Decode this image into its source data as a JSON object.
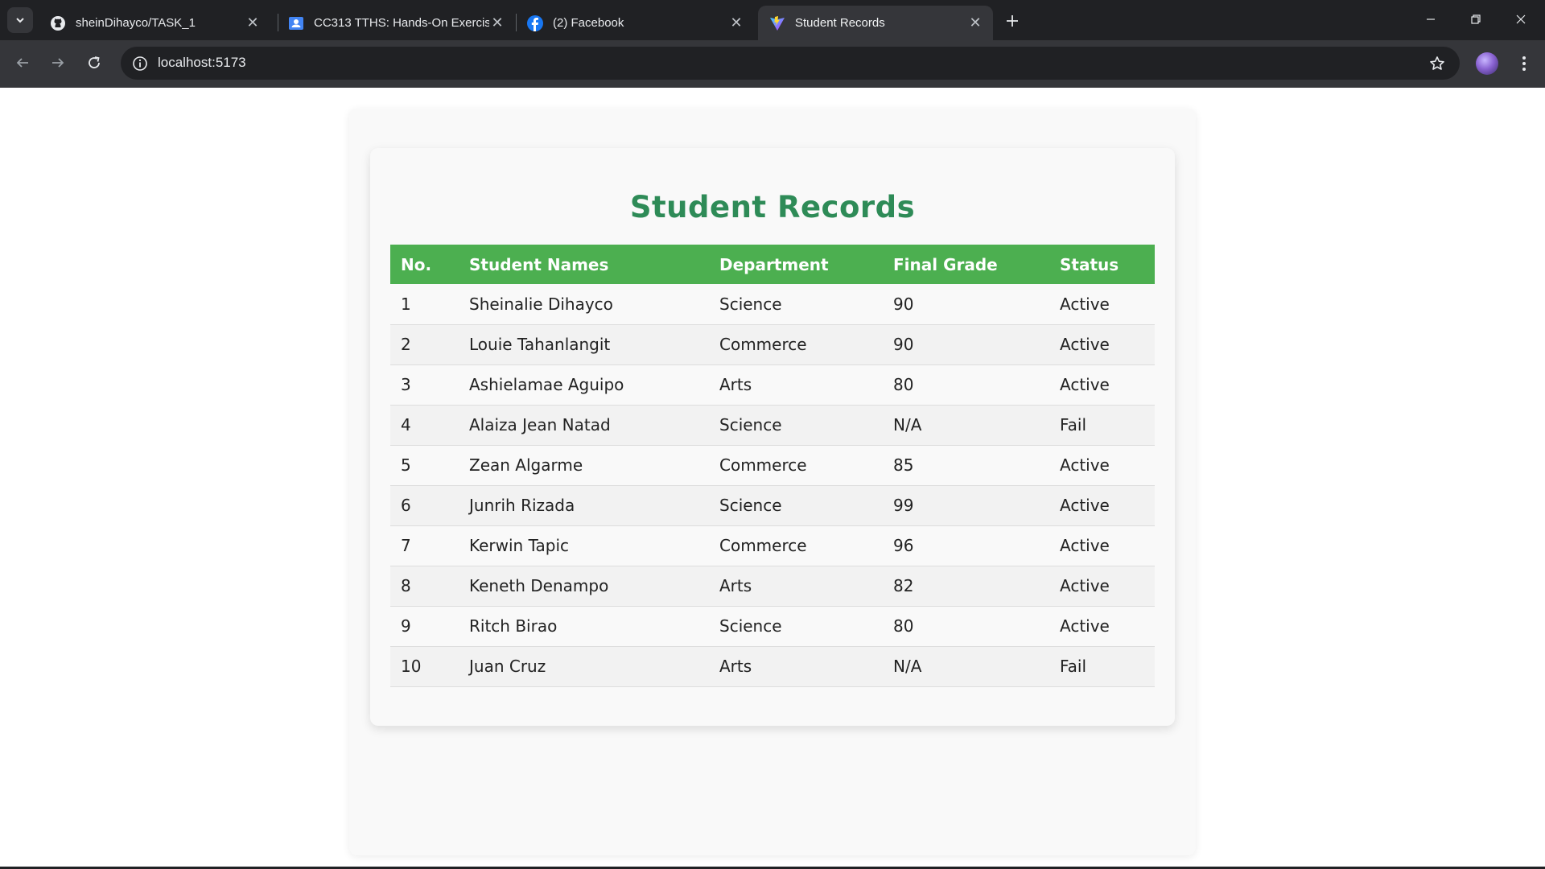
{
  "browser": {
    "tabs": [
      {
        "title": "sheinDihayco/TASK_1",
        "icon": "github-icon",
        "active": false
      },
      {
        "title": "CC313 TTHS: Hands-On Exercis",
        "icon": "classroom-icon",
        "active": false
      },
      {
        "title": "(2) Facebook",
        "icon": "facebook-icon",
        "active": false
      },
      {
        "title": "Student Records",
        "icon": "vite-icon",
        "active": true
      }
    ],
    "url": "localhost:5173"
  },
  "page": {
    "title": "Student Records",
    "table": {
      "headers": [
        "No.",
        "Student Names",
        "Department",
        "Final Grade",
        "Status"
      ],
      "rows": [
        [
          "1",
          "Sheinalie Dihayco",
          "Science",
          "90",
          "Active"
        ],
        [
          "2",
          "Louie Tahanlangit",
          "Commerce",
          "90",
          "Active"
        ],
        [
          "3",
          "Ashielamae Aguipo",
          "Arts",
          "80",
          "Active"
        ],
        [
          "4",
          "Alaiza Jean Natad",
          "Science",
          "N/A",
          "Fail"
        ],
        [
          "5",
          "Zean Algarme",
          "Commerce",
          "85",
          "Active"
        ],
        [
          "6",
          "Junrih Rizada",
          "Science",
          "99",
          "Active"
        ],
        [
          "7",
          "Kerwin Tapic",
          "Commerce",
          "96",
          "Active"
        ],
        [
          "8",
          "Keneth Denampo",
          "Arts",
          "82",
          "Active"
        ],
        [
          "9",
          "Ritch Birao",
          "Science",
          "80",
          "Active"
        ],
        [
          "10",
          "Juan Cruz",
          "Arts",
          "N/A",
          "Fail"
        ]
      ]
    }
  },
  "colors": {
    "title": "#2e8b57",
    "header_bg": "#4caf50",
    "row_alt": "#f2f2f2"
  }
}
